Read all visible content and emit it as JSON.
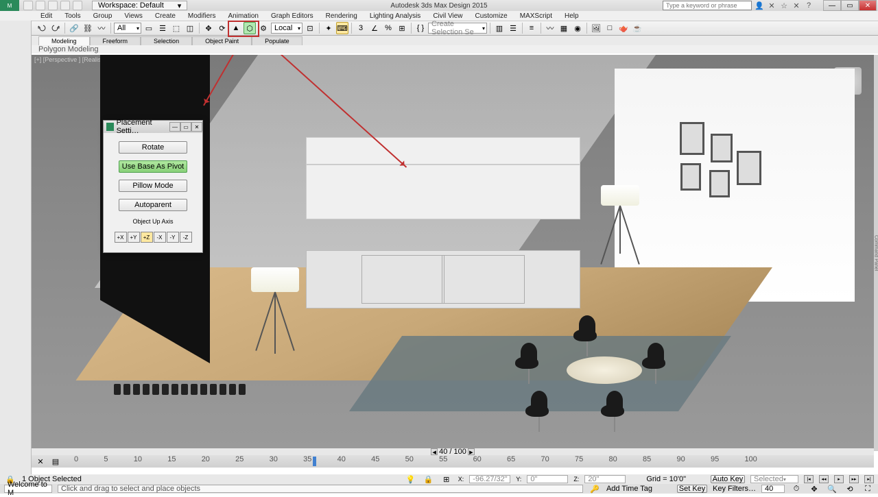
{
  "titlebar": {
    "workspace_label": "Workspace: Default",
    "app_title": "Autodesk 3ds Max Design 2015",
    "search_placeholder": "Type a keyword or phrase"
  },
  "menu": [
    "Edit",
    "Tools",
    "Group",
    "Views",
    "Create",
    "Modifiers",
    "Animation",
    "Graph Editors",
    "Rendering",
    "Lighting Analysis",
    "Civil View",
    "Customize",
    "MAXScript",
    "Help"
  ],
  "toolbar": {
    "selfilter": "All",
    "coord": "Local",
    "selset": "Create Selection Se"
  },
  "ribbon": {
    "tabs": [
      "Modeling",
      "Freeform",
      "Selection",
      "Object Paint",
      "Populate"
    ],
    "panel": "Polygon Modeling"
  },
  "viewport": {
    "label": "[+] [Perspective ] [Realistic ]"
  },
  "dialog": {
    "title": "Placement Setti…",
    "rotate": "Rotate",
    "usebase": "Use Base As Pivot",
    "pillow": "Pillow Mode",
    "autoparent": "Autoparent",
    "axislabel": "Object Up Axis",
    "axes": [
      "+X",
      "+Y",
      "+Z",
      "-X",
      "-Y",
      "-Z"
    ]
  },
  "timeline": {
    "ticks": [
      "0",
      "5",
      "10",
      "15",
      "20",
      "25",
      "30",
      "35",
      "40",
      "45",
      "50",
      "55",
      "60",
      "65",
      "70",
      "75",
      "80",
      "85",
      "90",
      "95",
      "100"
    ],
    "pos": "40 / 100"
  },
  "status": {
    "selcount": "1 Object Selected",
    "x_label": "X:",
    "x_val": "-96.27/32\"",
    "y_label": "Y:",
    "y_val": "0\"",
    "z_label": "Z:",
    "z_val": "20\"",
    "grid": "Grid = 10'0\"",
    "autokey": "Auto Key",
    "selected": "Selected",
    "welcome": "Welcome to M",
    "prompt": "Click and drag to select and place objects",
    "addtag": "Add Time Tag",
    "setkey": "Set Key",
    "keyfilters": "Key Filters…",
    "frame": "40"
  }
}
